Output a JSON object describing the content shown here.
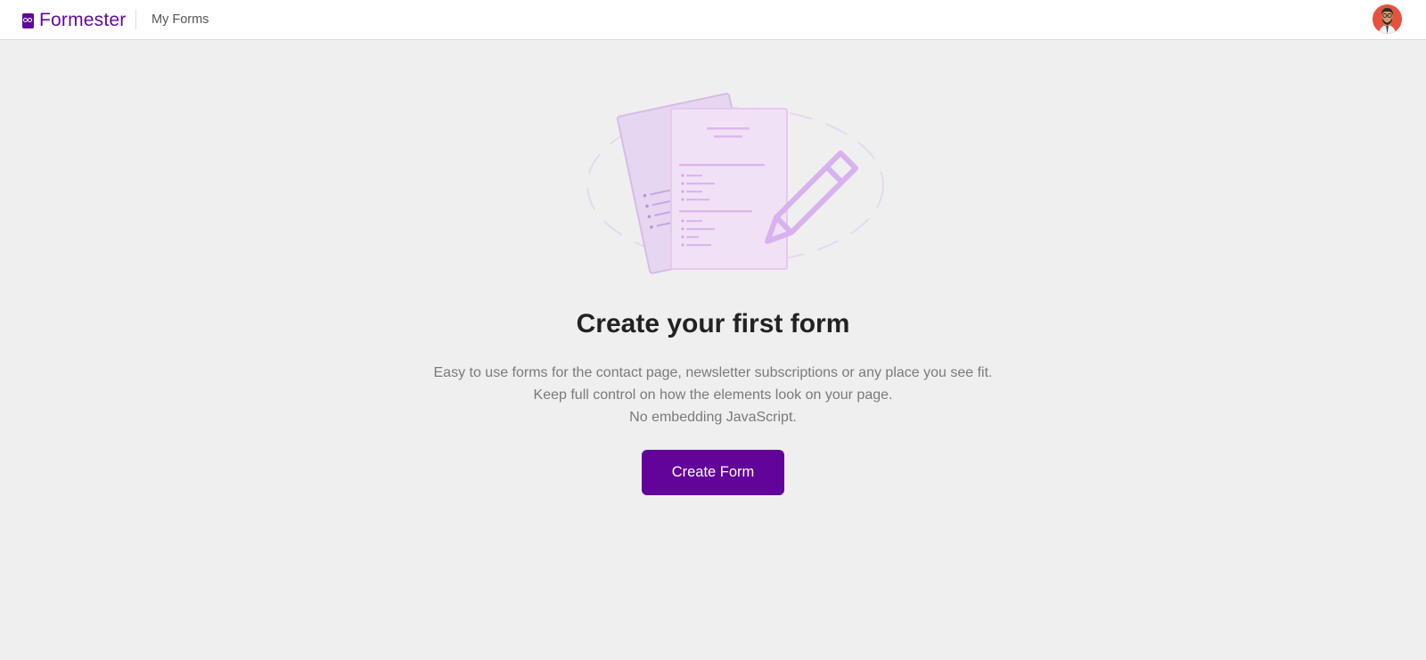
{
  "header": {
    "brand": "Formester",
    "nav_link": "My Forms"
  },
  "empty_state": {
    "title": "Create your first form",
    "description_lines": [
      "Easy to use forms for the contact page, newsletter subscriptions or any place you see fit.",
      "Keep full control on how the elements look on your page.",
      "No embedding JavaScript."
    ],
    "cta_label": "Create Form"
  },
  "colors": {
    "brand_purple": "#620399",
    "background": "#efefef",
    "illustration_purple": "#d9b8ee"
  },
  "icons": {
    "logo": "formester-logo-icon",
    "avatar": "user-avatar-icon",
    "illustration": "forms-and-pencil-illustration"
  }
}
